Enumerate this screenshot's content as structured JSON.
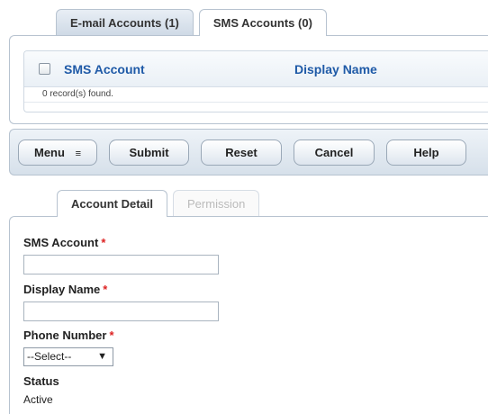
{
  "top_tabs": [
    {
      "label": "E-mail Accounts (1)"
    },
    {
      "label": "SMS Accounts (0)"
    }
  ],
  "grid": {
    "columns": [
      "SMS Account",
      "Display Name"
    ],
    "records_text": "0 record(s) found."
  },
  "toolbar": {
    "menu_label": "Menu",
    "menu_glyph": "≡",
    "submit_label": "Submit",
    "reset_label": "Reset",
    "cancel_label": "Cancel",
    "help_label": "Help"
  },
  "detail_tabs": [
    {
      "label": "Account Detail"
    },
    {
      "label": "Permission"
    }
  ],
  "form": {
    "sms_account_label": "SMS Account",
    "display_name_label": "Display Name",
    "phone_number_label": "Phone Number",
    "required_marker": "*",
    "phone_select_value": "--Select--",
    "status_label": "Status",
    "status_value": "Active"
  },
  "colors": {
    "accent": "#1f5aa7",
    "required": "#d22222",
    "border": "#b7c3d0"
  }
}
